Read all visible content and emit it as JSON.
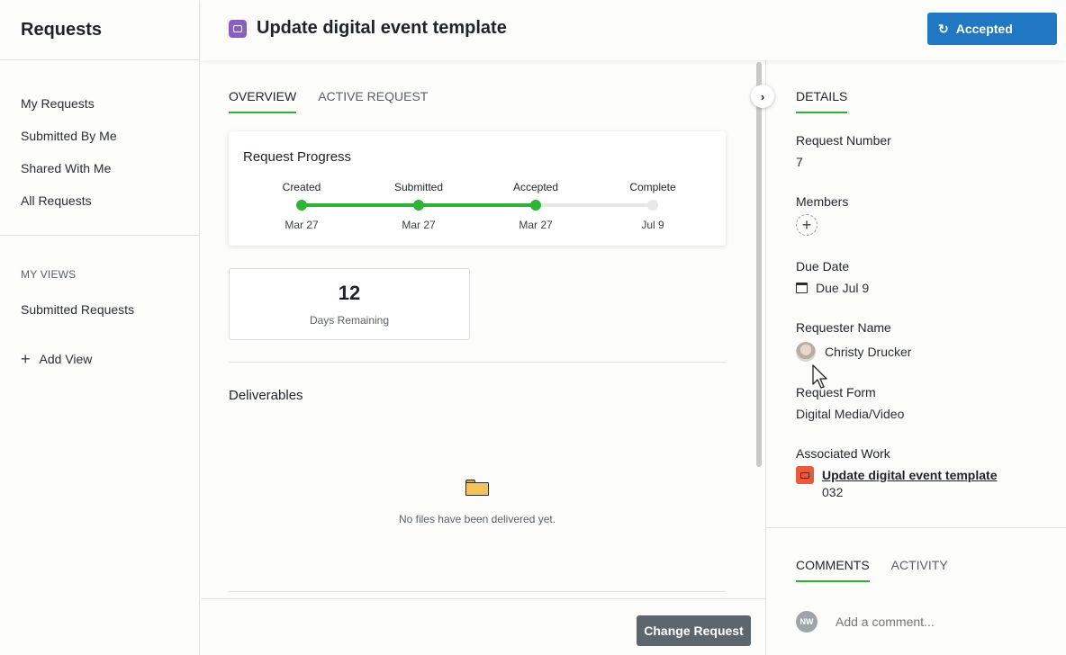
{
  "sidebar": {
    "title": "Requests",
    "items": [
      {
        "label": "My Requests"
      },
      {
        "label": "Submitted By Me"
      },
      {
        "label": "Shared With Me"
      },
      {
        "label": "All Requests"
      }
    ],
    "views_label": "MY VIEWS",
    "views": [
      {
        "label": "Submitted Requests"
      }
    ],
    "add_view_label": "Add View"
  },
  "header": {
    "title": "Update digital event template",
    "status_label": "Accepted",
    "status_color": "#1f78c1"
  },
  "main": {
    "tabs": [
      {
        "label": "OVERVIEW"
      },
      {
        "label": "ACTIVE REQUEST"
      }
    ],
    "progress": {
      "title": "Request Progress",
      "steps": [
        {
          "label": "Created",
          "date": "Mar 27",
          "done": true
        },
        {
          "label": "Submitted",
          "date": "Mar 27",
          "done": true
        },
        {
          "label": "Accepted",
          "date": "Mar 27",
          "done": true
        },
        {
          "label": "Complete",
          "date": "Jul 9",
          "done": false
        }
      ],
      "done_color": "#2db336",
      "pending_color": "#e6e7e8"
    },
    "days_remaining": {
      "value": "12",
      "label": "Days Remaining"
    },
    "deliverables": {
      "title": "Deliverables",
      "empty_text": "No files have been delivered yet."
    },
    "change_request_label": "Change Request"
  },
  "details": {
    "tab_label": "DETAILS",
    "request_number": {
      "label": "Request Number",
      "value": "7"
    },
    "members": {
      "label": "Members"
    },
    "due_date": {
      "label": "Due Date",
      "value": "Due Jul 9"
    },
    "requester": {
      "label": "Requester Name",
      "value": "Christy Drucker"
    },
    "request_form": {
      "label": "Request Form",
      "value": "Digital Media/Video"
    },
    "associated_work": {
      "label": "Associated Work",
      "link": "Update digital event template",
      "number": "032"
    }
  },
  "comments": {
    "tabs": [
      {
        "label": "COMMENTS"
      },
      {
        "label": "ACTIVITY"
      }
    ],
    "avatar_initials": "NW",
    "placeholder": "Add a comment..."
  }
}
